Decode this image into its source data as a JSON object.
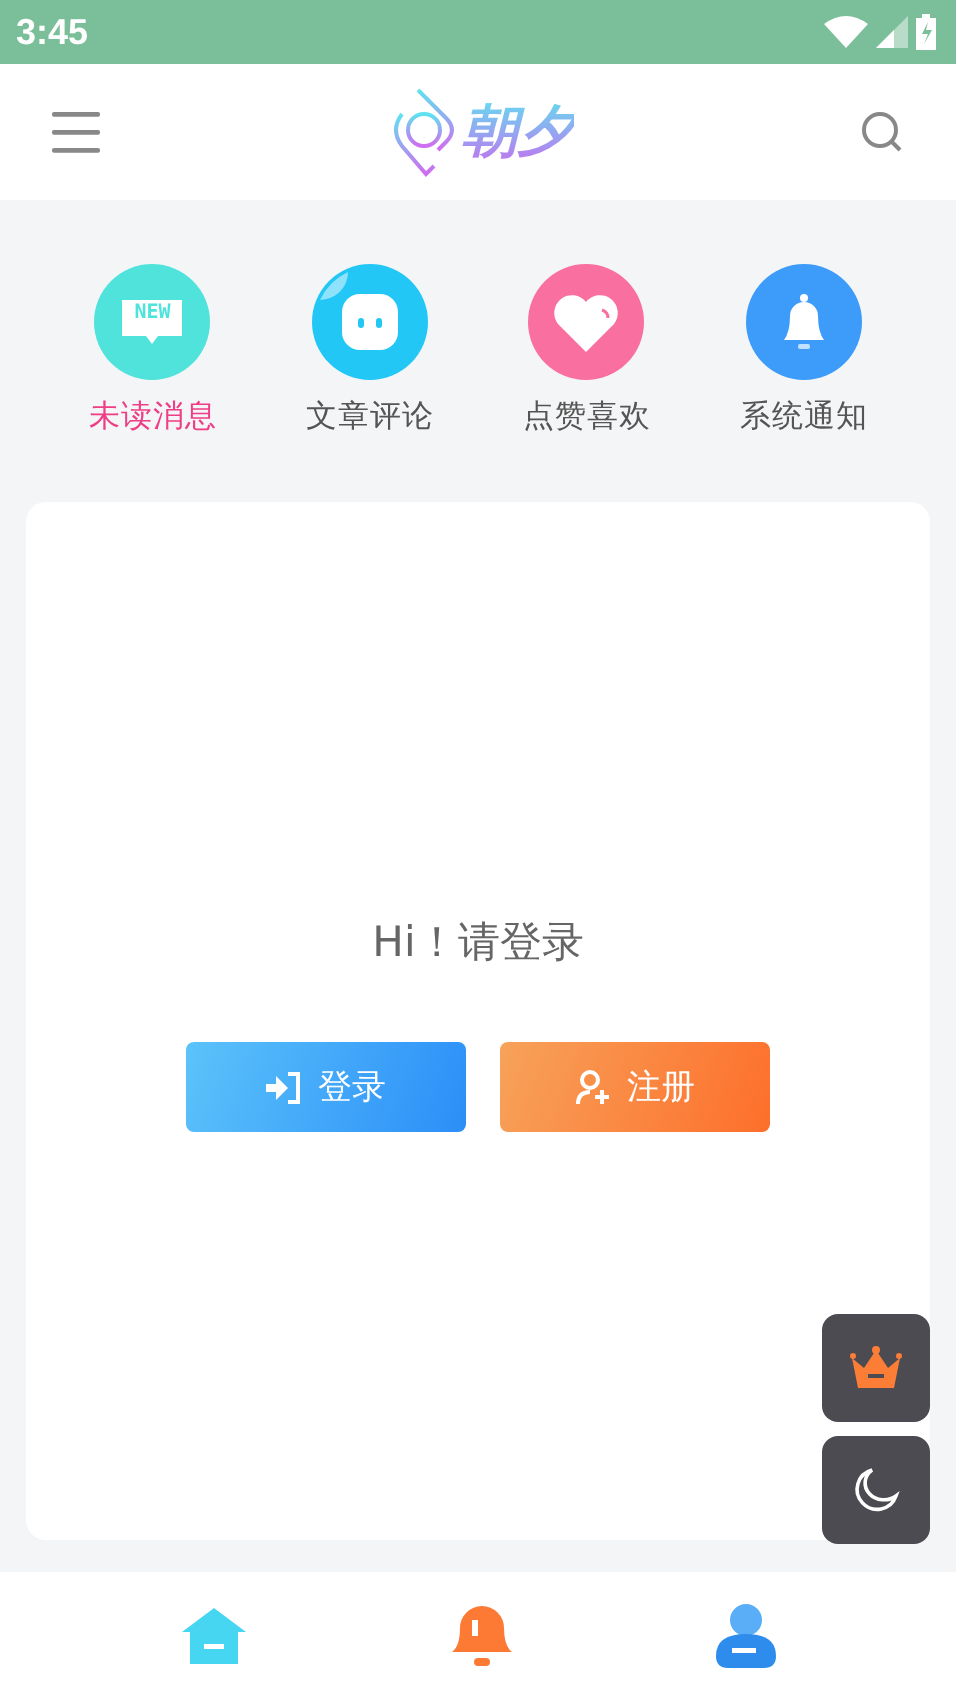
{
  "status_bar": {
    "time": "3:45"
  },
  "header": {
    "logo_text": "朝夕"
  },
  "shortcuts": [
    {
      "kind": "message",
      "label": "未读消息",
      "badge_text": "NEW",
      "selected": true
    },
    {
      "kind": "comment",
      "label": "文章评论",
      "selected": false
    },
    {
      "kind": "like",
      "label": "点赞喜欢",
      "selected": false
    },
    {
      "kind": "notice",
      "label": "系统通知",
      "selected": false
    }
  ],
  "login_card": {
    "greeting": "Hi！请登录",
    "buttons": [
      {
        "kind": "login",
        "label": "登录"
      },
      {
        "kind": "register",
        "label": "注册"
      }
    ]
  },
  "float_buttons": [
    {
      "kind": "vip"
    },
    {
      "kind": "dark_mode"
    }
  ],
  "bottom_nav": [
    {
      "kind": "home"
    },
    {
      "kind": "notice"
    },
    {
      "kind": "profile"
    }
  ]
}
